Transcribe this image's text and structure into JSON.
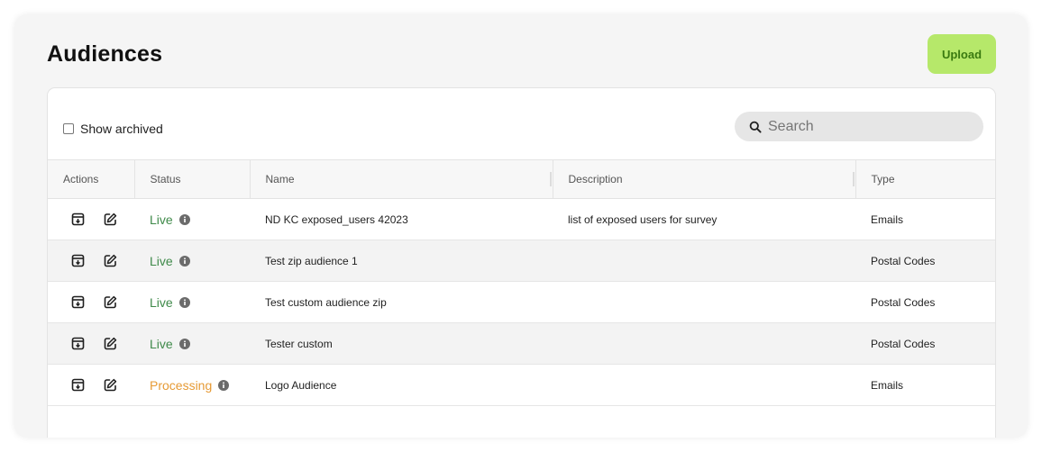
{
  "page": {
    "title": "Audiences",
    "upload_label": "Upload"
  },
  "colors": {
    "upload_bg": "#b6e86a",
    "upload_text": "#3a7a10",
    "live": "#3f8a4a",
    "processing": "#e69a34",
    "info_icon": "#6b6b6b"
  },
  "toolbar": {
    "show_archived_label": "Show archived",
    "show_archived_checked": false,
    "search_placeholder": "Search"
  },
  "table": {
    "columns": [
      "Actions",
      "Status",
      "Name",
      "Description",
      "Type"
    ],
    "rows": [
      {
        "status": "Live",
        "status_kind": "live",
        "name": "ND KC exposed_users 42023",
        "description": "list of exposed users for survey",
        "type": "Emails"
      },
      {
        "status": "Live",
        "status_kind": "live",
        "name": "Test zip audience 1",
        "description": "",
        "type": "Postal Codes"
      },
      {
        "status": "Live",
        "status_kind": "live",
        "name": "Test custom audience zip",
        "description": "",
        "type": "Postal Codes"
      },
      {
        "status": "Live",
        "status_kind": "live",
        "name": "Tester custom",
        "description": "",
        "type": "Postal Codes"
      },
      {
        "status": "Processing",
        "status_kind": "processing",
        "name": "Logo Audience",
        "description": "",
        "type": "Emails"
      }
    ]
  },
  "icons": {
    "download": "archive-download-icon",
    "edit": "edit-icon",
    "info": "info-icon",
    "search": "search-icon"
  }
}
